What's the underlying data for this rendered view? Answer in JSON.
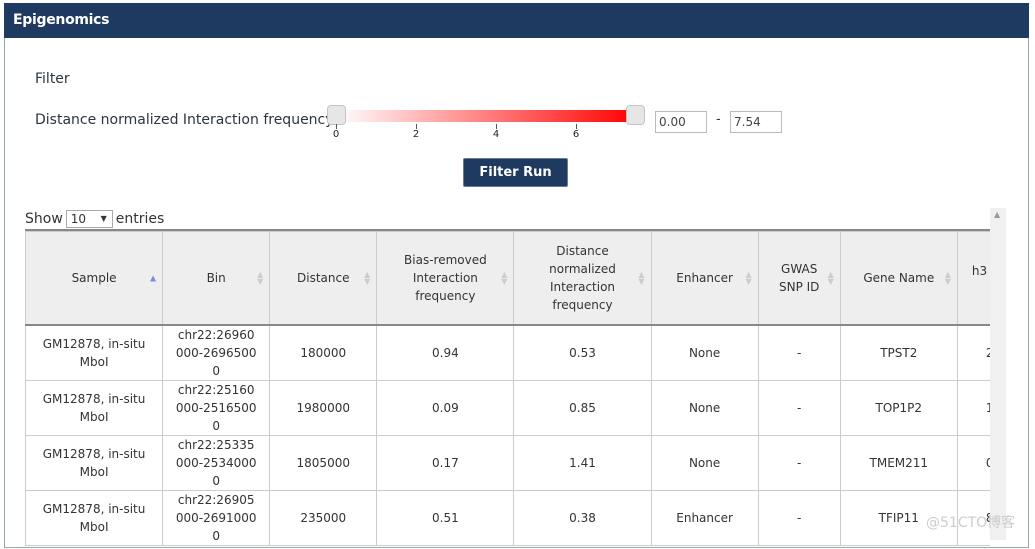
{
  "header": {
    "title": "Epigenomics"
  },
  "filter": {
    "title": "Filter",
    "label": "Distance normalized Interaction frequency :",
    "slider": {
      "min": 0,
      "max": 7.54,
      "low": 0,
      "high": 7.54,
      "ticks": [
        "0",
        "2",
        "4",
        "6"
      ],
      "gradient": [
        "#ffffff",
        "#ff0000"
      ]
    },
    "min_value": "0.00",
    "separator": "-",
    "max_value": "7.54",
    "run_label": "Filter Run"
  },
  "length": {
    "show": "Show",
    "value": "10",
    "entries": "entries"
  },
  "table": {
    "columns": [
      "Sample",
      "Bin",
      "Distance",
      "Bias-removed Interaction frequency",
      "Distance normalized Interaction frequency",
      "Enhancer",
      "GWAS SNP ID",
      "Gene Name",
      "h3"
    ],
    "rows": [
      [
        "GM12878, in-situ MboI",
        "chr22:26960000-26965000",
        "180000",
        "0.94",
        "0.53",
        "None",
        "-",
        "TPST2",
        "2"
      ],
      [
        "GM12878, in-situ MboI",
        "chr22:25160000-25165000",
        "1980000",
        "0.09",
        "0.85",
        "None",
        "-",
        "TOP1P2",
        "1"
      ],
      [
        "GM12878, in-situ MboI",
        "chr22:25335000-25340000",
        "1805000",
        "0.17",
        "1.41",
        "None",
        "-",
        "TMEM211",
        "0"
      ],
      [
        "GM12878, in-situ MboI",
        "chr22:26905000-26910000",
        "235000",
        "0.51",
        "0.38",
        "Enhancer",
        "-",
        "TFIP11",
        "8"
      ]
    ]
  },
  "watermark": "@51CTO博客"
}
